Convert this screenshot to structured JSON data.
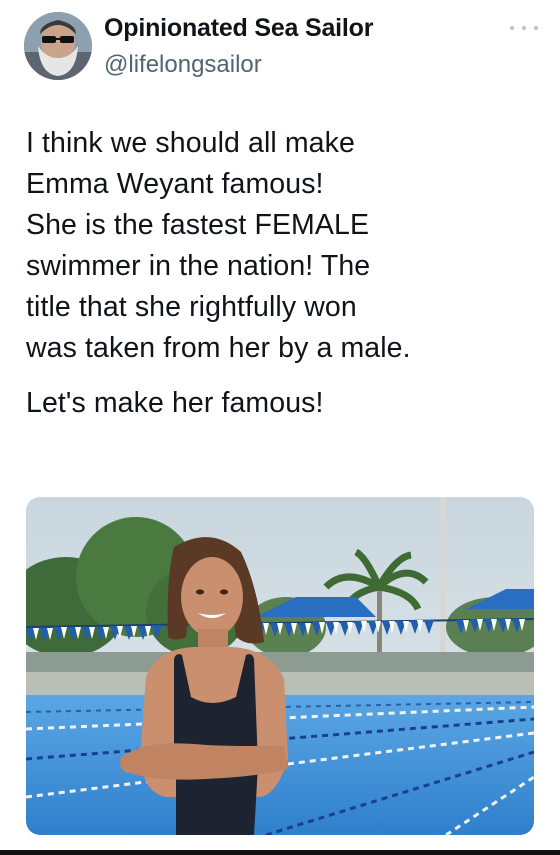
{
  "author": {
    "display_name": "Opinionated Sea Sailor",
    "handle": "@lifelongsailor"
  },
  "tweet": {
    "lines": [
      "I think we should all make",
      "Emma Weyant famous!",
      "She is the fastest FEMALE",
      "swimmer in the nation!  The",
      "title that she rightfully won",
      "was taken from her by a male.",
      "Let's make her famous!"
    ]
  },
  "media": {
    "subject": "swimmer-standing-at-outdoor-pool"
  },
  "icons": {
    "more": "more-icon",
    "avatar": "avatar"
  },
  "colors": {
    "text": "#0f1419",
    "secondary_text": "#536471",
    "pool_water": "#3f8fd6",
    "bunting_blue": "#1f5fae"
  }
}
